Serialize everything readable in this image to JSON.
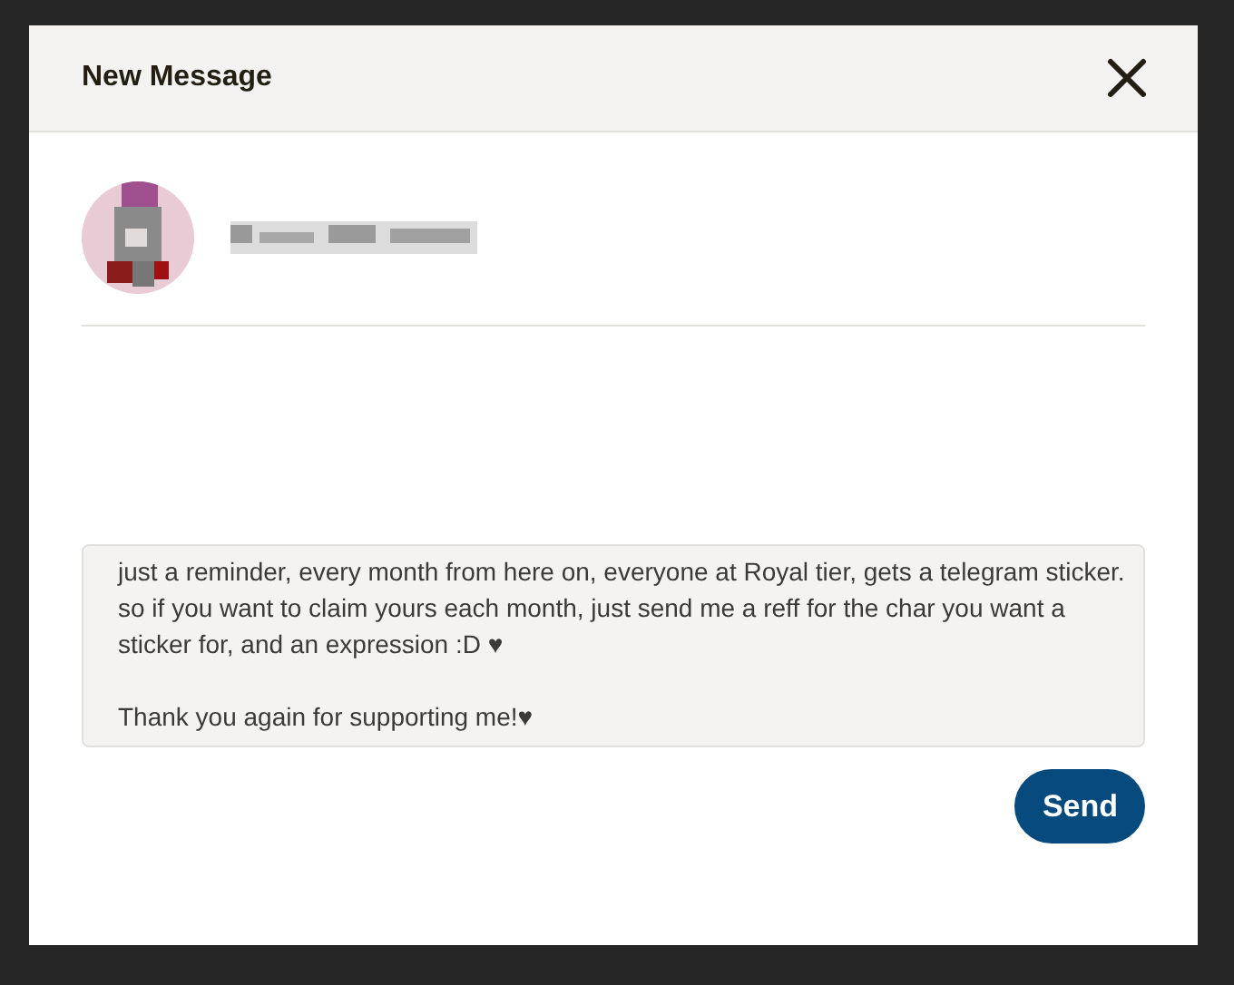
{
  "dialog": {
    "title": "New Message",
    "message": {
      "value": "just a reminder, every month from here on, everyone at Royal tier, gets a telegram sticker. so if you want to claim yours each month, just send me a reff for the char you want a sticker for, and an expression :D ♥\n\nThank you again for supporting me!♥"
    },
    "send_button": "Send"
  }
}
